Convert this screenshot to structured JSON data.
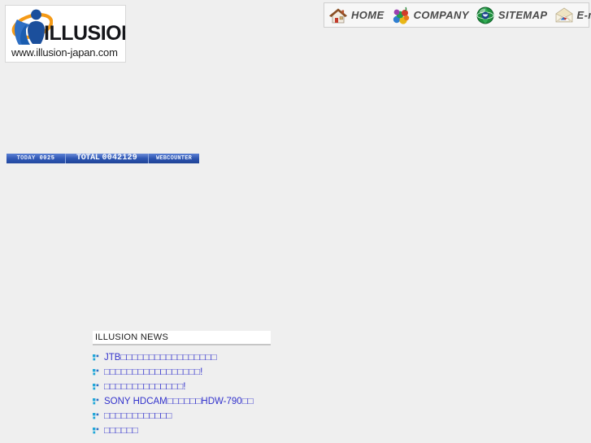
{
  "site": {
    "logo": {
      "wordmark": "ILLUSION",
      "url": "www.illusion-japan.com",
      "mark_icon": "person-swoosh-logo-icon"
    },
    "background_color": "#efefef"
  },
  "topnav": {
    "items": [
      {
        "label": "HOME",
        "icon": "house-icon"
      },
      {
        "label": "COMPANY",
        "icon": "building-blocks-icon"
      },
      {
        "label": "SITEMAP",
        "icon": "globe-icon"
      },
      {
        "label": "E-mail",
        "icon": "envelope-icon"
      }
    ],
    "label_color": "#4a4a4a"
  },
  "counter": {
    "today_label": "TODAY",
    "today_value": "0025",
    "total_label": "TOTAL",
    "total_value": "0042129",
    "brand": "WEBCOUNTER",
    "color": "#2b54b4"
  },
  "news": {
    "heading": "ILLUSION NEWS",
    "link_color": "#3333cc",
    "bullet_icon": "square-cluster-bullet-icon",
    "items": [
      {
        "text": "JTB□□□□□□□□□□□□□□□□□"
      },
      {
        "text": "□□□□□□□□□□□□□□□□□!"
      },
      {
        "text": "□□□□□□□□□□□□□□!"
      },
      {
        "text": "SONY HDCAM□□□□□□HDW-790□□"
      },
      {
        "text": "□□□□□□□□□□□□"
      },
      {
        "text": "□□□□□□"
      }
    ]
  }
}
